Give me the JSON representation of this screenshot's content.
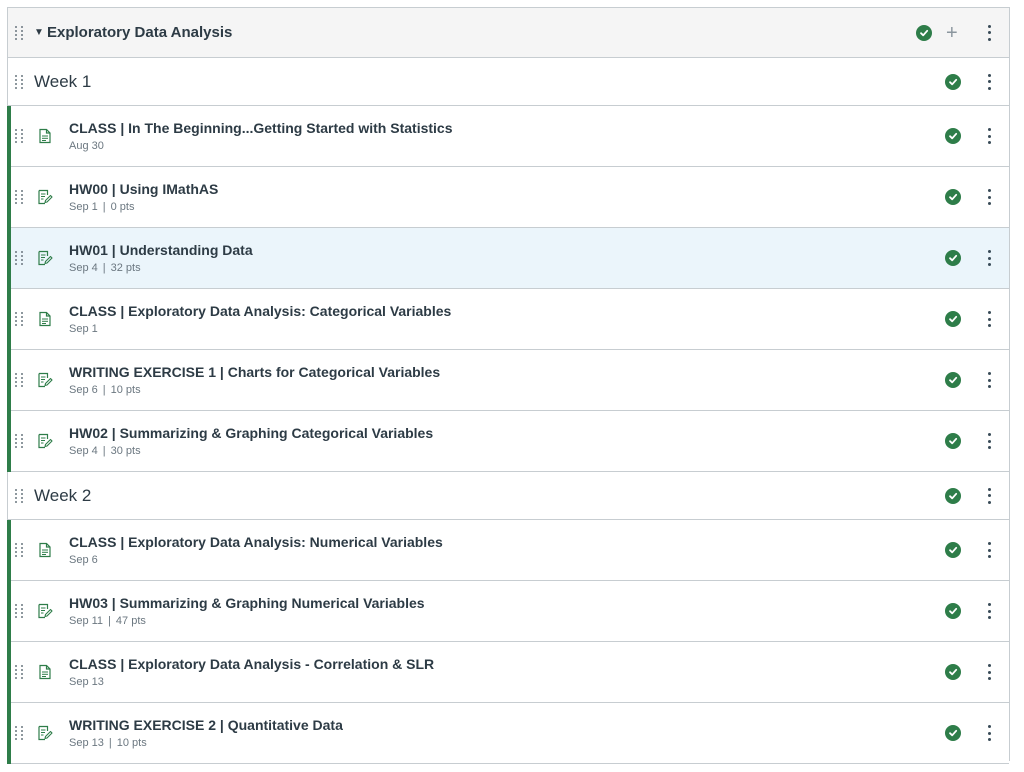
{
  "module": {
    "title": "Exploratory Data Analysis",
    "icons": [
      "drag-handle-icon",
      "caret-down-icon",
      "published-check-icon",
      "plus-icon",
      "kebab-menu-icon"
    ]
  },
  "colors": {
    "published": "#2e7d49",
    "highlight_row": "#ebf5fb",
    "header_bg": "#f5f5f5",
    "border": "#c7cdd1"
  },
  "rows": [
    {
      "kind": "subheader",
      "title": "Week 1"
    },
    {
      "kind": "item",
      "type": "page",
      "title": "CLASS | In The Beginning...Getting Started with Statistics",
      "date": "Aug 30",
      "points": ""
    },
    {
      "kind": "item",
      "type": "assignment",
      "title": "HW00 | Using IMathAS",
      "date": "Sep 1",
      "points": "0 pts"
    },
    {
      "kind": "item",
      "type": "assignment",
      "title": "HW01 | Understanding Data",
      "date": "Sep 4",
      "points": "32 pts",
      "highlight": true
    },
    {
      "kind": "item",
      "type": "page",
      "title": "CLASS | Exploratory Data Analysis: Categorical Variables",
      "date": "Sep 1",
      "points": ""
    },
    {
      "kind": "item",
      "type": "assignment",
      "title": "WRITING EXERCISE 1 | Charts for Categorical Variables",
      "date": "Sep 6",
      "points": "10 pts"
    },
    {
      "kind": "item",
      "type": "assignment",
      "title": "HW02 | Summarizing & Graphing Categorical Variables",
      "date": "Sep 4",
      "points": "30 pts"
    },
    {
      "kind": "subheader",
      "title": "Week 2"
    },
    {
      "kind": "item",
      "type": "page",
      "title": "CLASS | Exploratory Data Analysis: Numerical Variables",
      "date": "Sep 6",
      "points": ""
    },
    {
      "kind": "item",
      "type": "assignment",
      "title": "HW03 | Summarizing & Graphing Numerical Variables",
      "date": "Sep 11",
      "points": "47 pts"
    },
    {
      "kind": "item",
      "type": "page",
      "title": "CLASS | Exploratory Data Analysis - Correlation & SLR",
      "date": "Sep 13",
      "points": ""
    },
    {
      "kind": "item",
      "type": "assignment",
      "title": "WRITING EXERCISE 2 | Quantitative Data",
      "date": "Sep 13",
      "points": "10 pts"
    }
  ]
}
